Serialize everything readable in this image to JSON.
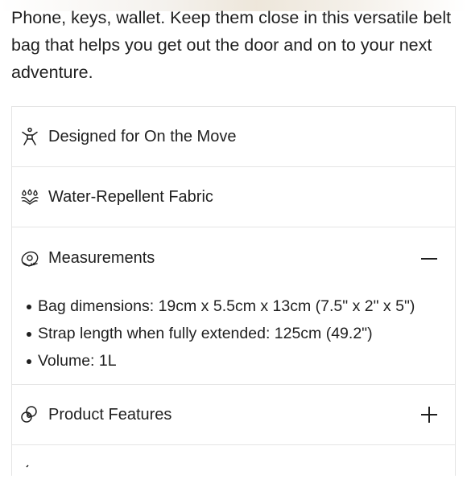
{
  "description": "Phone, keys, wallet. Keep them close in this versatile belt bag that helps you get out the door and on to your next adventure.",
  "accordion": {
    "items": [
      {
        "label": "Designed for On the Move",
        "icon": "person-moving-icon"
      },
      {
        "label": "Water-Repellent Fabric",
        "icon": "water-drops-icon"
      },
      {
        "label": "Measurements",
        "icon": "tape-measure-icon",
        "expanded": true,
        "details": [
          "Bag dimensions: 19cm x 5.5cm x 13cm (7.5\" x 2\" x 5\")",
          "Strap length when fully extended: 125cm (49.2\")",
          "Volume: 1L"
        ]
      },
      {
        "label": "Product Features",
        "icon": "features-circles-icon",
        "expanded": false
      }
    ]
  }
}
